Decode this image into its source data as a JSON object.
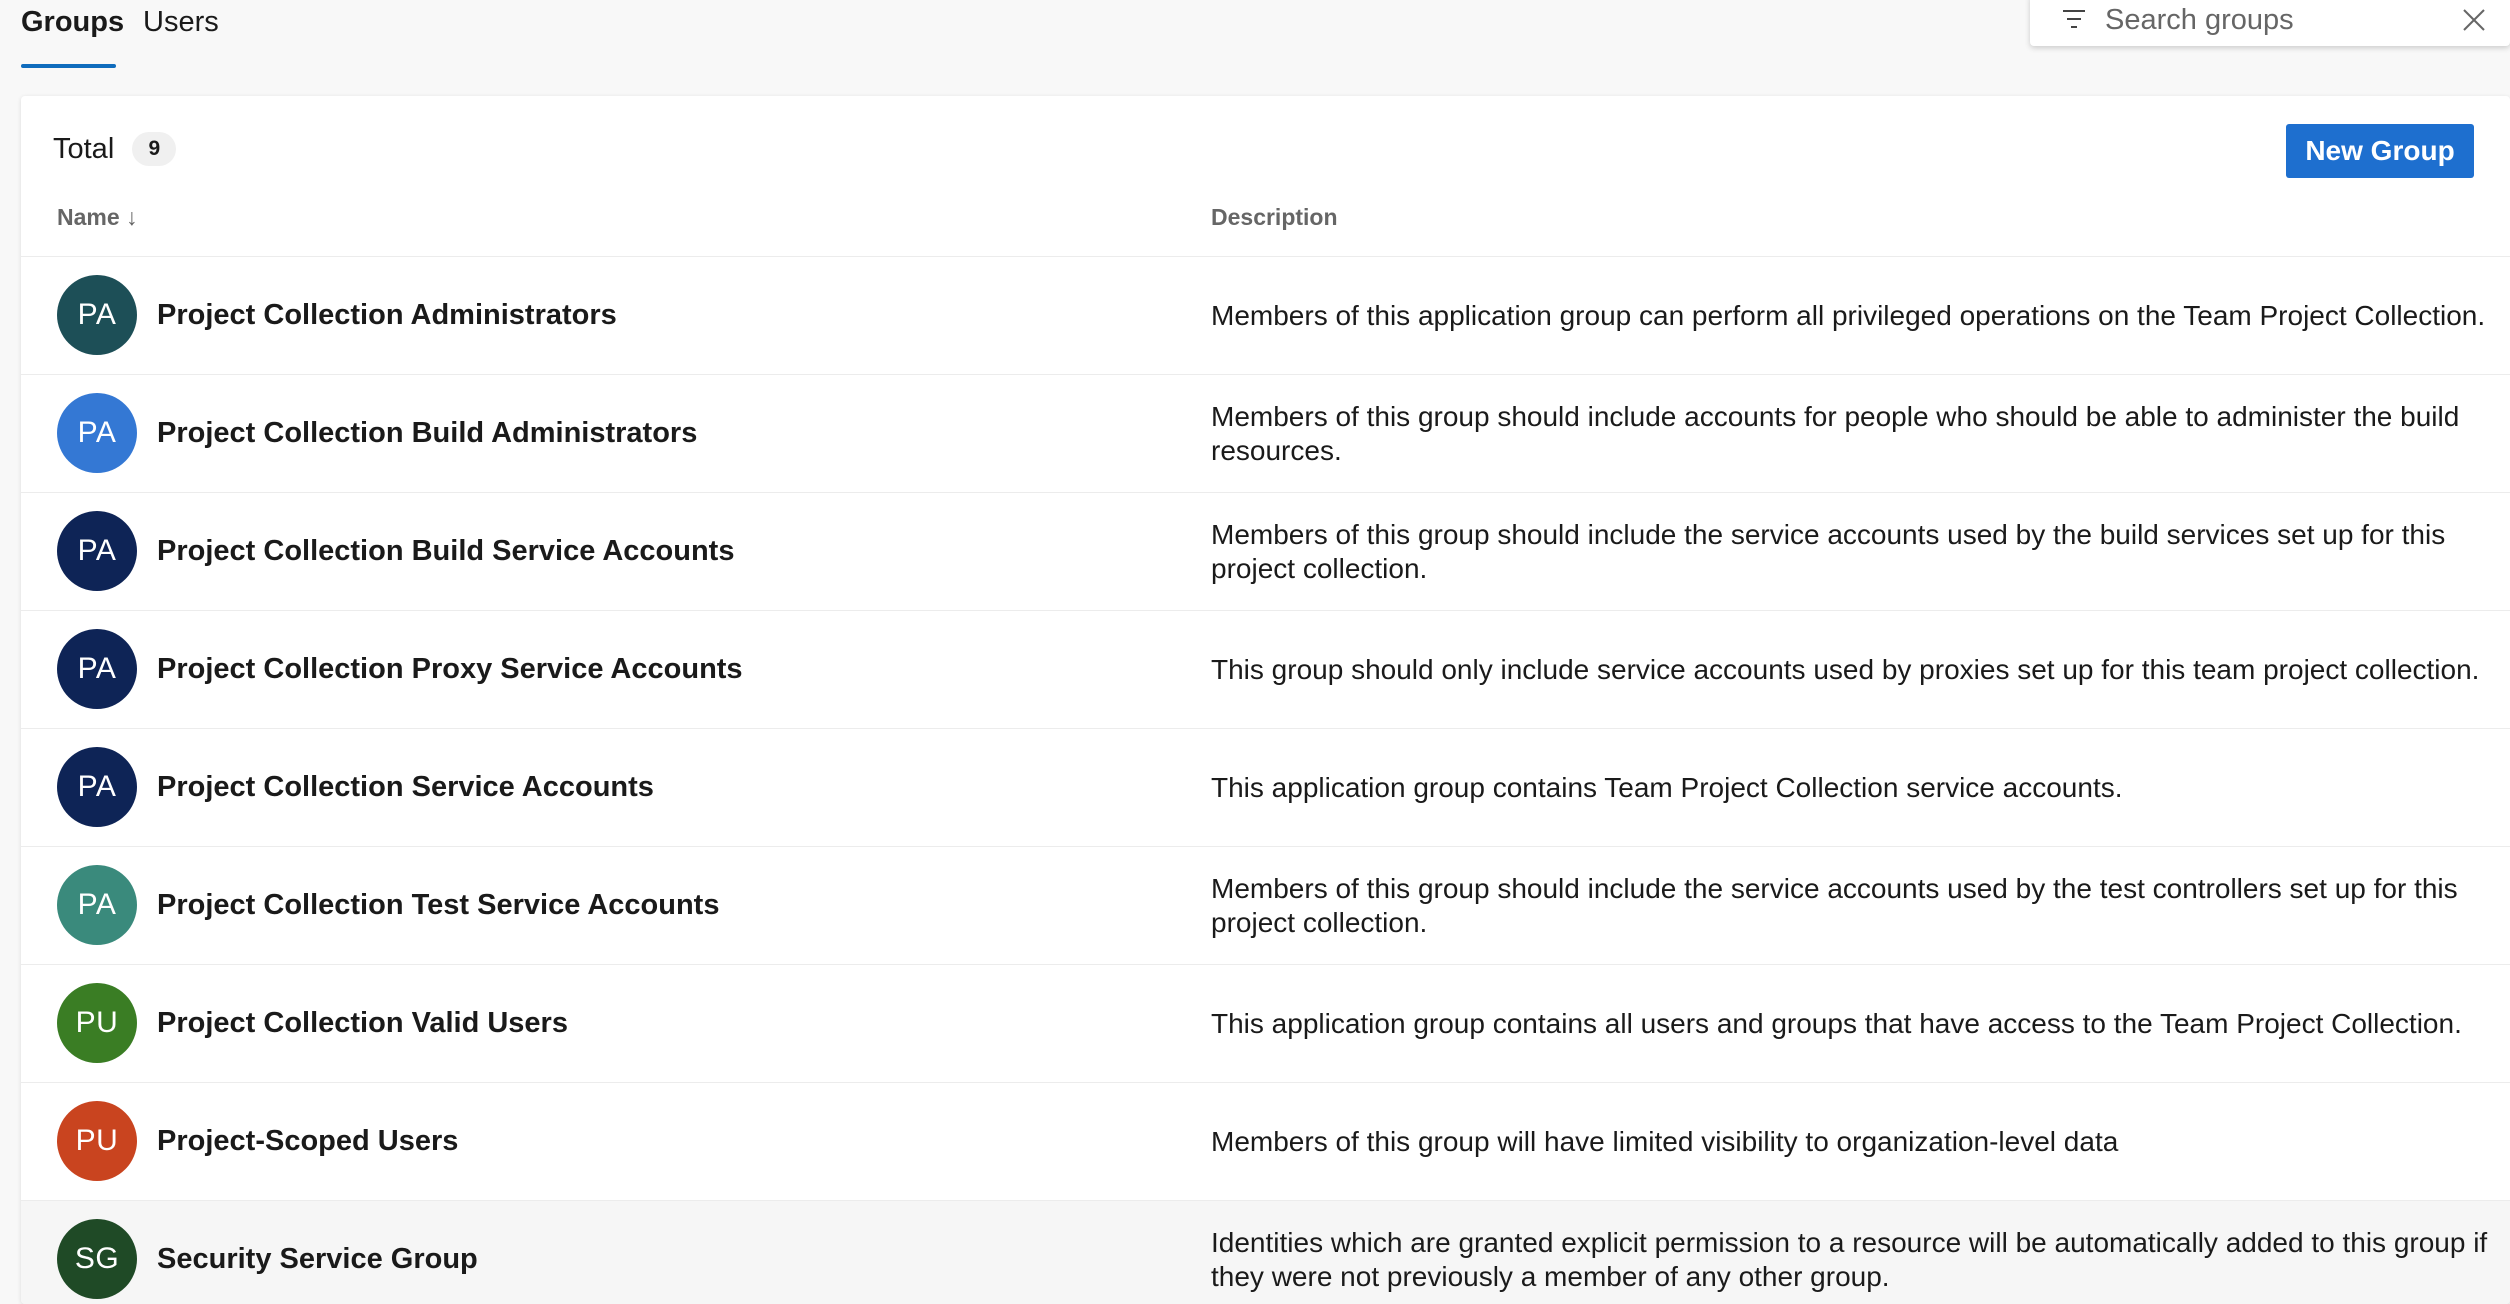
{
  "tabs": [
    {
      "label": "Groups",
      "selected": true
    },
    {
      "label": "Users",
      "selected": false
    }
  ],
  "search": {
    "placeholder": "Search groups",
    "value": "",
    "filter_icon": "filter-icon",
    "close_icon": "close-icon"
  },
  "summary": {
    "total_label": "Total",
    "total_count": "9"
  },
  "toolbar": {
    "new_group_label": "New Group"
  },
  "columns": {
    "name": "Name ↓",
    "description": "Description"
  },
  "colors": {
    "accent": "#1e6fcf",
    "tab_underline": "#0f6cbd"
  },
  "groups": [
    {
      "initials": "PA",
      "color": "#1d4f57",
      "name": "Project Collection Administrators",
      "description": "Members of this application group can perform all privileged operations on the Team Project Collection."
    },
    {
      "initials": "PA",
      "color": "#3478d4",
      "name": "Project Collection Build Administrators",
      "description": "Members of this group should include accounts for people who should be able to administer the build resources."
    },
    {
      "initials": "PA",
      "color": "#0e2456",
      "name": "Project Collection Build Service Accounts",
      "description": "Members of this group should include the service accounts used by the build services set up for this project collection."
    },
    {
      "initials": "PA",
      "color": "#0e2456",
      "name": "Project Collection Proxy Service Accounts",
      "description": "This group should only include service accounts used by proxies set up for this team project collection."
    },
    {
      "initials": "PA",
      "color": "#0e2456",
      "name": "Project Collection Service Accounts",
      "description": "This application group contains Team Project Collection service accounts."
    },
    {
      "initials": "PA",
      "color": "#3a8a7c",
      "name": "Project Collection Test Service Accounts",
      "description": "Members of this group should include the service accounts used by the test controllers set up for this project collection."
    },
    {
      "initials": "PU",
      "color": "#3a7d24",
      "name": "Project Collection Valid Users",
      "description": "This application group contains all users and groups that have access to the Team Project Collection."
    },
    {
      "initials": "PU",
      "color": "#c9441f",
      "name": "Project-Scoped Users",
      "description": "Members of this group will have limited visibility to organization-level data"
    },
    {
      "initials": "SG",
      "color": "#1f4a26",
      "name": "Security Service Group",
      "description": "Identities which are granted explicit permission to a resource will be automatically added to this group if they were not previously a member of any other group."
    }
  ]
}
